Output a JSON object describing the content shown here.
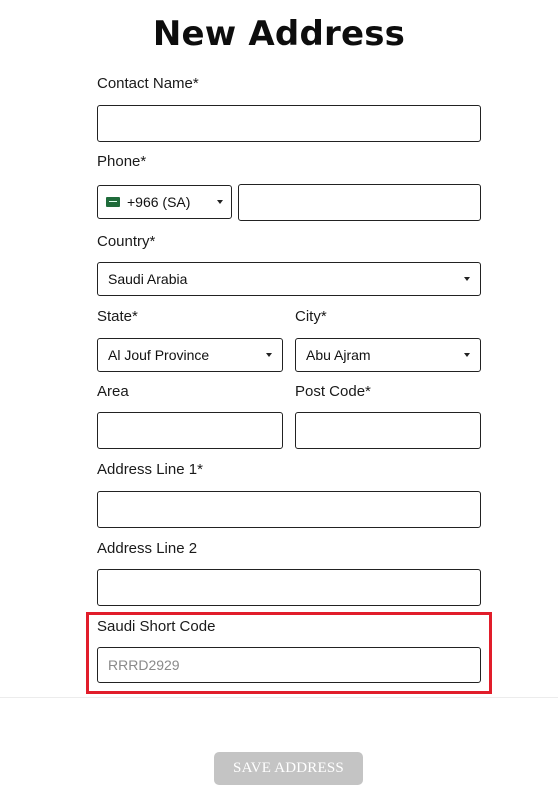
{
  "title": "New Address",
  "fields": {
    "contact_name": {
      "label": "Contact Name*",
      "value": ""
    },
    "phone": {
      "label": "Phone*",
      "country_code": "+966 (SA)",
      "value": ""
    },
    "country": {
      "label": "Country*",
      "value": "Saudi Arabia"
    },
    "state": {
      "label": "State*",
      "value": "Al Jouf Province"
    },
    "city": {
      "label": "City*",
      "value": "Abu Ajram"
    },
    "area": {
      "label": "Area",
      "value": ""
    },
    "post_code": {
      "label": "Post Code*",
      "value": ""
    },
    "address_line_1": {
      "label": "Address Line 1*",
      "value": ""
    },
    "address_line_2": {
      "label": "Address Line 2",
      "value": ""
    },
    "short_code": {
      "label": "Saudi Short Code",
      "placeholder": "RRRD2929",
      "value": ""
    }
  },
  "actions": {
    "save_label": "SAVE ADDRESS"
  },
  "colors": {
    "highlight": "#e11d2a",
    "button_bg": "#c4c4c4",
    "flag": "#1f6b3a"
  },
  "icons": {
    "flag": "saudi-flag-icon",
    "dropdown": "caret-down-icon"
  }
}
